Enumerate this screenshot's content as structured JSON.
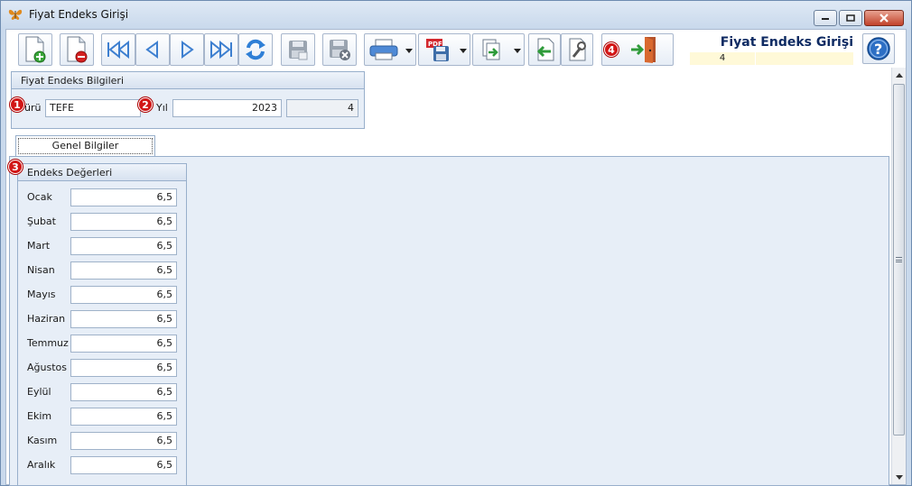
{
  "window": {
    "title": "Fiyat Endeks Girişi",
    "title_icon": "butterfly-icon"
  },
  "toolbar": {
    "buttons": [
      {
        "name": "new-record-button",
        "icon": "add-document-icon"
      },
      {
        "name": "delete-record-button",
        "icon": "delete-document-icon"
      },
      {
        "name": "first-record-button",
        "icon": "first-icon"
      },
      {
        "name": "previous-record-button",
        "icon": "previous-icon"
      },
      {
        "name": "next-record-button",
        "icon": "next-icon"
      },
      {
        "name": "last-record-button",
        "icon": "last-icon"
      },
      {
        "name": "refresh-button",
        "icon": "refresh-icon"
      },
      {
        "name": "save-button",
        "icon": "save-icon"
      },
      {
        "name": "cancel-save-button",
        "icon": "save-cancel-icon"
      },
      {
        "name": "print-button",
        "icon": "printer-icon"
      },
      {
        "name": "export-pdf-button",
        "icon": "pdf-icon"
      },
      {
        "name": "export-button",
        "icon": "export-icon"
      },
      {
        "name": "import-button",
        "icon": "import-icon"
      },
      {
        "name": "settings-button",
        "icon": "wrench-icon"
      },
      {
        "name": "exit-button",
        "icon": "exit-door-icon"
      }
    ],
    "form_title": "Fiyat Endeks Girişi",
    "record_number": "4"
  },
  "badges": {
    "b1": "1",
    "b2": "2",
    "b3": "3",
    "b4": "4"
  },
  "info_panel": {
    "header": "Fiyat Endeks Bilgileri",
    "type_label": "ürü",
    "type_value": "TEFE",
    "year_label": "Yıl",
    "year_value": "2023",
    "id_value": "4"
  },
  "tabs": {
    "general": "Genel Bilgiler"
  },
  "endeks_panel": {
    "header": "Endeks Değerleri",
    "months": [
      {
        "label": "Ocak",
        "value": "6,5"
      },
      {
        "label": "Şubat",
        "value": "6,5"
      },
      {
        "label": "Mart",
        "value": "6,5"
      },
      {
        "label": "Nisan",
        "value": "6,5"
      },
      {
        "label": "Mayıs",
        "value": "6,5"
      },
      {
        "label": "Haziran",
        "value": "6,5"
      },
      {
        "label": "Temmuz",
        "value": "6,5"
      },
      {
        "label": "Ağustos",
        "value": "6,5"
      },
      {
        "label": "Eylül",
        "value": "6,5"
      },
      {
        "label": "Ekim",
        "value": "6,5"
      },
      {
        "label": "Kasım",
        "value": "6,5"
      },
      {
        "label": "Aralık",
        "value": "6,5"
      }
    ]
  },
  "colors": {
    "badge": "#d21616",
    "title": "#0f2b63",
    "panel_bg": "#e7eef7"
  }
}
